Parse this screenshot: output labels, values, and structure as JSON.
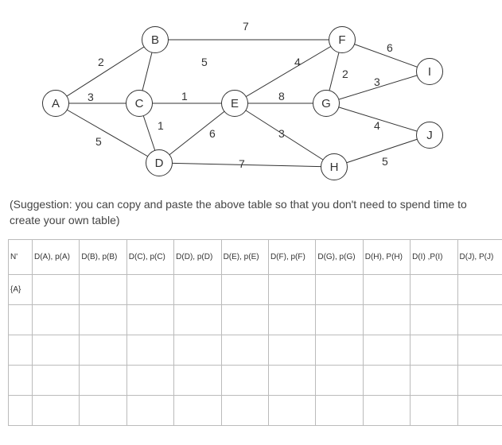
{
  "graph": {
    "nodes": {
      "A": "A",
      "B": "B",
      "C": "C",
      "D": "D",
      "E": "E",
      "F": "F",
      "G": "G",
      "H": "H",
      "I": "I",
      "J": "J"
    },
    "edge_weights": {
      "AB": "2",
      "AC": "3",
      "AD": "5",
      "BC": "5",
      "BF": "7",
      "CD": "1",
      "CE": "1",
      "DE": "6",
      "DH": "7",
      "EF": "4",
      "EG": "8",
      "EH": "3",
      "FG": "2",
      "FI": "6",
      "GI": "3",
      "GJ": "4",
      "HJ": "5"
    }
  },
  "suggestion_text": "(Suggestion: you can copy and paste the above table so that you don't need to spend time to create your own table)",
  "table": {
    "headers": {
      "nprime": "N'",
      "A": "D(A), p(A)",
      "B": "D(B), p(B)",
      "C": "D(C), p(C)",
      "D": "D(D), p(D)",
      "E": "D(E), p(E)",
      "F": "D(F), p(F)",
      "G": "D(G), p(G)",
      "H": "D(H), P(H)",
      "I": "D(I) ,P(I)",
      "J": "D(J), P(J)"
    },
    "rows_first_col": [
      "{A}",
      "",
      "",
      "",
      ""
    ]
  }
}
